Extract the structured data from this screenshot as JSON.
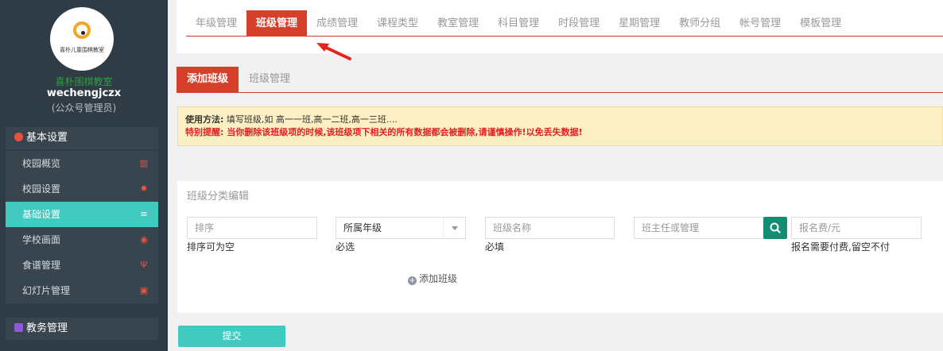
{
  "sidebar": {
    "logo_text": "喜朴儿童围棋教室",
    "school_name": "喜朴围棋教室",
    "username": "wechengjczx",
    "role": "(公众号管理员)",
    "group1_label": "基本设置",
    "items": [
      {
        "label": "校园概览",
        "icon": "bank-icon"
      },
      {
        "label": "校园设置",
        "icon": "gear-icon"
      },
      {
        "label": "基础设置",
        "icon": "list-icon"
      },
      {
        "label": "学校画面",
        "icon": "eye-icon"
      },
      {
        "label": "食谱管理",
        "icon": "cutlery-icon"
      },
      {
        "label": "幻灯片管理",
        "icon": "image-icon"
      }
    ],
    "group2_label": "教务管理"
  },
  "top_tabs": [
    "年级管理",
    "班级管理",
    "成绩管理",
    "课程类型",
    "教室管理",
    "科目管理",
    "时段管理",
    "星期管理",
    "教师分组",
    "帐号管理",
    "模板管理"
  ],
  "sub_tabs": [
    "添加班级",
    "班级管理"
  ],
  "notice": {
    "label": "使用方法:",
    "usage": "填写班级,如 高一一班,高一二班,高一三班....",
    "warning": "特别提醒: 当你删除该班级项的时候,该班级项下相关的所有数据都会被删除,请谨慎操作!以免丢失数据!"
  },
  "form": {
    "title": "班级分类编辑",
    "sort_placeholder": "排序",
    "sort_hint": "排序可为空",
    "grade_select": "所属年级",
    "grade_hint": "必选",
    "name_placeholder": "班级名称",
    "name_hint": "必填",
    "teacher_placeholder": "班主任或管理",
    "fee_placeholder": "报名费/元",
    "fee_hint": "报名需要付费,留空不付",
    "add_label": "添加班级",
    "submit_label": "提交"
  },
  "colors": {
    "accent": "#d6402a",
    "teal": "#41cac0",
    "sidebar": "#2f3b45"
  }
}
